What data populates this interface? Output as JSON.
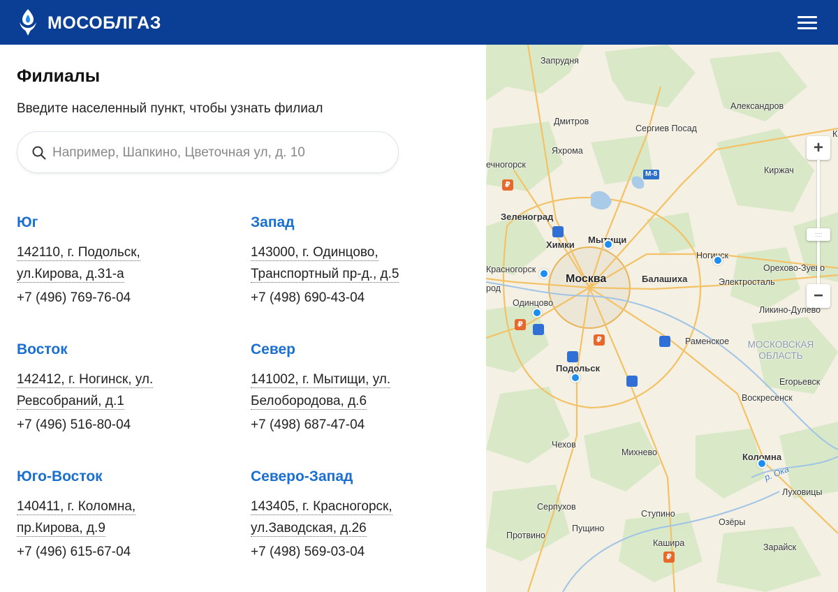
{
  "header": {
    "brand": "МОСОБЛГАЗ",
    "logo_icon": "flame-logo-icon",
    "menu_icon": "hamburger-menu-icon",
    "colors": {
      "background": "#0a3f95",
      "text": "#ffffff"
    }
  },
  "page": {
    "title": "Филиалы",
    "subtitle": "Введите населенный пункт, чтобы узнать филиал"
  },
  "search": {
    "placeholder": "Например, Шапкино, Цветочная ул, д. 10",
    "value": "",
    "icon": "search-icon"
  },
  "branches": [
    {
      "name": "Юг",
      "address_line1": "142110, г. Подольск,",
      "address_line2": "ул.Кирова, д.31-а",
      "phone": "+7 (496) 769-76-04"
    },
    {
      "name": "Запад",
      "address_line1": "143000, г. Одинцово,",
      "address_line2": "Транспортный пр-д., д.5",
      "phone": "+7 (498) 690-43-04"
    },
    {
      "name": "Восток",
      "address_line1": "142412, г. Ногинск, ул.",
      "address_line2": "Ревсобраний, д.1",
      "phone": "+7 (496) 516-80-04"
    },
    {
      "name": "Север",
      "address_line1": "141002, г. Мытищи, ул.",
      "address_line2": "Белобородова, д.6",
      "phone": "+7 (498) 687-47-04"
    },
    {
      "name": "Юго-Восток",
      "address_line1": "140411, г. Коломна,",
      "address_line2": "пр.Кирова, д.9",
      "phone": "+7 (496) 615-67-04"
    },
    {
      "name": "Северо-Запад",
      "address_line1": "143405, г. Красногорск,",
      "address_line2": "ул.Заводская, д.26",
      "phone": "+7 (498) 569-03-04"
    }
  ],
  "map": {
    "labels": {
      "zaprudnya": "Запрудня",
      "aleksandrov": "Александров",
      "dmitrov": "Дмитров",
      "sergiev_posad": "Сергиев Посад",
      "yakhroma": "Яхрома",
      "solnechnogorsk": "ечногорск",
      "kirzhach": "Киржач",
      "zelenograd": "Зеленоград",
      "khimki": "Химки",
      "mytishchi": "Мытищи",
      "noginsk": "Ногинск",
      "krasnogorsk": "Красногорск",
      "moskva": "Москва",
      "balashikha": "Балашиха",
      "orekhovo_zuevo": "Орехово-Зуево",
      "elektrostal": "Электросталь",
      "zvenigorod": "род",
      "odintsovo": "Одинцово",
      "likino_dulevo": "Ликино-Дулево",
      "ramenskoe": "Раменское",
      "region_line1": "МОСКОВСКАЯ",
      "region_line2": "ОБЛАСТЬ",
      "podolsk": "Подольск",
      "egorevsk": "Егорьевск",
      "voskresensk": "Воскресенск",
      "chekhov": "Чехов",
      "mikhnevo": "Михнево",
      "kolomna": "Коломна",
      "oka_river": "р. Ока",
      "serpukhov": "Серпухов",
      "stupino": "Ступино",
      "lukhovitsy": "Луховицы",
      "ozyory": "Озёры",
      "protvino": "Протвино",
      "pushchino": "Пущино",
      "kashira": "Кашира",
      "zaraysk": "Зарайск",
      "k_edge": "К",
      "m8_road": "М-8"
    },
    "zoom": {
      "plus": "+",
      "minus": "−",
      "handle": "::::"
    },
    "marker_color": "#1d8ef0"
  }
}
